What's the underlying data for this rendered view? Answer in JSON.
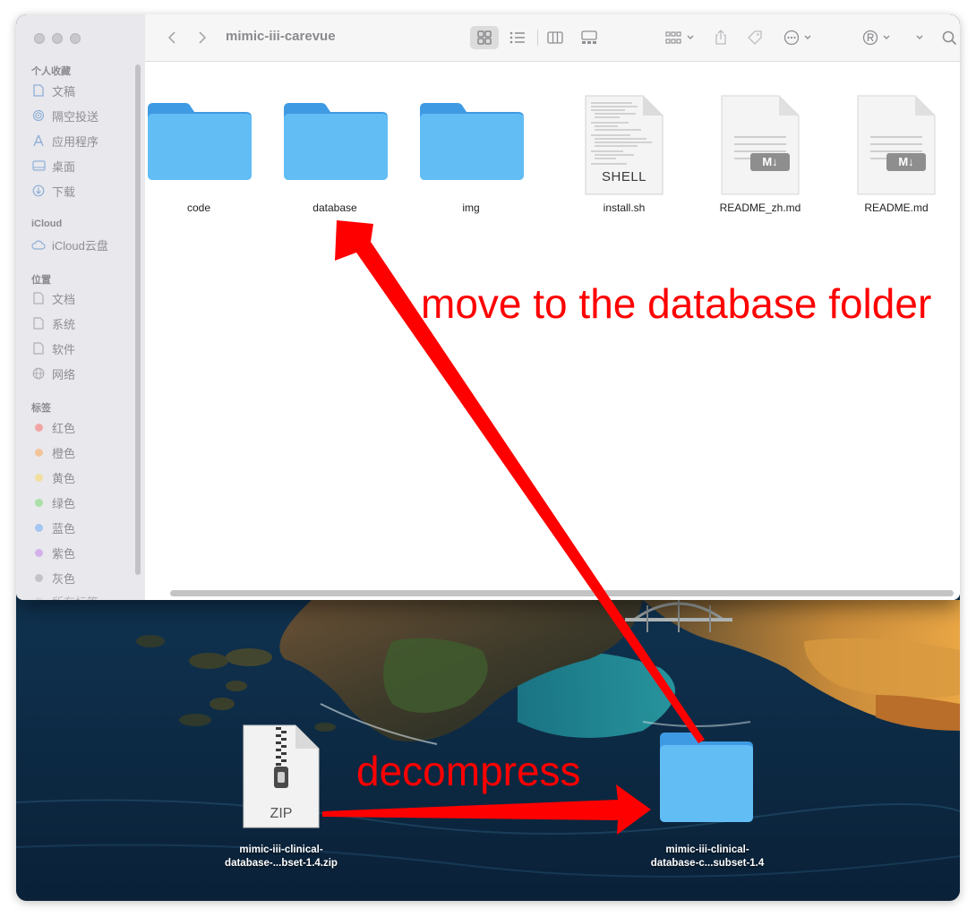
{
  "window": {
    "title": "mimic-iii-carevue"
  },
  "toolbar": {
    "back_icon": "chevron-left-icon",
    "forward_icon": "chevron-right-icon",
    "view_icon_grid": "grid-view-icon",
    "view_icon_list": "list-view-icon",
    "view_icon_columns": "column-view-icon",
    "view_icon_gallery": "gallery-view-icon",
    "group_icon": "group-icon",
    "share_icon": "share-icon",
    "tag_icon": "tag-icon",
    "more_icon": "ellipsis-icon",
    "registered_icon": "registered-icon",
    "search_icon": "search-icon"
  },
  "sidebar": {
    "favorites_title": "个人收藏",
    "favorites": [
      {
        "label": "文稿",
        "icon": "document-icon"
      },
      {
        "label": "隔空投送",
        "icon": "airdrop-icon"
      },
      {
        "label": "应用程序",
        "icon": "applications-icon"
      },
      {
        "label": "桌面",
        "icon": "desktop-icon"
      },
      {
        "label": "下载",
        "icon": "downloads-icon"
      }
    ],
    "icloud_title": "iCloud",
    "icloud": [
      {
        "label": "iCloud云盘",
        "icon": "cloud-icon"
      }
    ],
    "locations_title": "位置",
    "locations": [
      {
        "label": "文档",
        "icon": "file-icon"
      },
      {
        "label": "系统",
        "icon": "file-icon"
      },
      {
        "label": "软件",
        "icon": "file-icon"
      },
      {
        "label": "网络",
        "icon": "network-icon"
      }
    ],
    "tags_title": "标签",
    "tags": [
      {
        "label": "红色",
        "color": "#f2a5a5"
      },
      {
        "label": "橙色",
        "color": "#f2c59a"
      },
      {
        "label": "黄色",
        "color": "#f2dfa0"
      },
      {
        "label": "绿色",
        "color": "#a9dfa8"
      },
      {
        "label": "蓝色",
        "color": "#a6c6f2"
      },
      {
        "label": "紫色",
        "color": "#d2b2e8"
      },
      {
        "label": "灰色",
        "color": "#c4c4c6"
      }
    ],
    "more_tags": "所有标签"
  },
  "files": [
    {
      "name": "code",
      "kind": "folder"
    },
    {
      "name": "database",
      "kind": "folder"
    },
    {
      "name": "img",
      "kind": "folder"
    },
    {
      "name": "install.sh",
      "kind": "shell",
      "badge": "SHELL"
    },
    {
      "name": "README_zh.md",
      "kind": "markdown",
      "badge": "M↓"
    },
    {
      "name": "README.md",
      "kind": "markdown",
      "badge": "M↓"
    }
  ],
  "desktop": {
    "zip": {
      "line1": "mimic-iii-clinical-",
      "line2": "database-...bset-1.4.zip",
      "badge": "ZIP"
    },
    "folder": {
      "line1": "mimic-iii-clinical-",
      "line2": "database-c...subset-1.4"
    }
  },
  "annotations": {
    "move": "move to the database folder",
    "decompress": "decompress",
    "color": "#ff0000"
  }
}
